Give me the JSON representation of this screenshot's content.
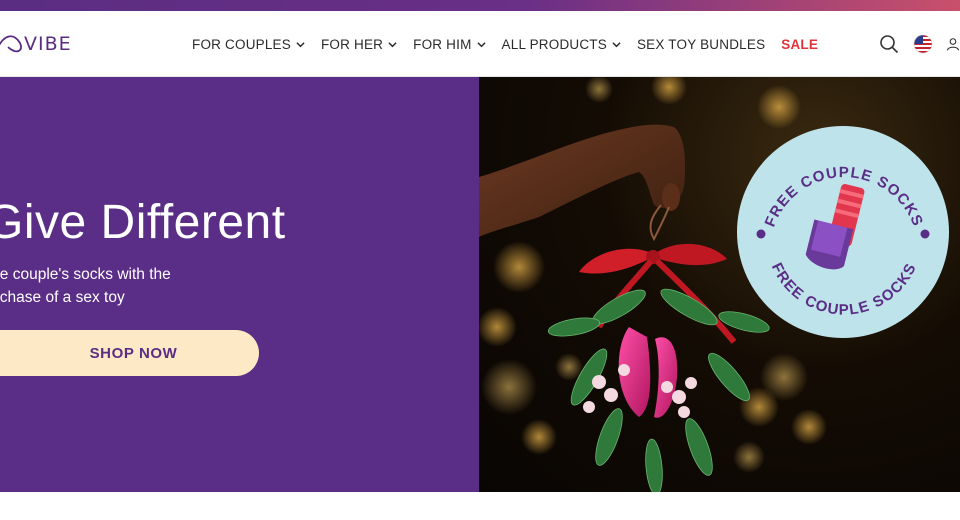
{
  "brand": {
    "logo_text": "VIBE",
    "accent": "#5a2d86",
    "sale_color": "#e0333c"
  },
  "nav": {
    "items": [
      {
        "label": "FOR COUPLES",
        "has_dropdown": true
      },
      {
        "label": "FOR HER",
        "has_dropdown": true
      },
      {
        "label": "FOR HIM",
        "has_dropdown": true
      },
      {
        "label": "ALL PRODUCTS",
        "has_dropdown": true
      },
      {
        "label": "SEX TOY BUNDLES",
        "has_dropdown": false
      },
      {
        "label": "SALE",
        "has_dropdown": false
      }
    ]
  },
  "header_icons": [
    "search-icon",
    "us-flag-icon",
    "account-icon"
  ],
  "hero": {
    "title": "Give Different",
    "subtitle_line1": "ree couple's socks with the",
    "subtitle_line2": "urchase of a sex toy",
    "cta_label": "SHOP NOW",
    "cta_bg": "#fde9c6",
    "badge_text_top": "FREE COUPLE SOCKS",
    "badge_text_bottom": "FREE COUPLE SOCKS",
    "badge_bg": "#bfe3ea"
  }
}
